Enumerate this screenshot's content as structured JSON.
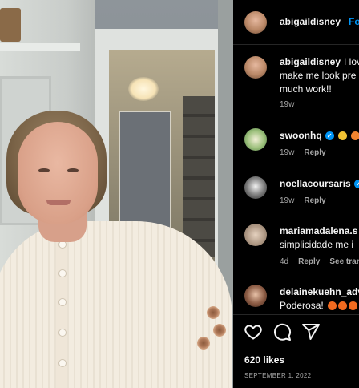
{
  "header": {
    "username": "abigaildisney",
    "follow_label": "Fo"
  },
  "caption": {
    "username": "abigaildisney",
    "line1": "I lov",
    "line2": "make me look pre",
    "line3": "much work!!",
    "time": "19w"
  },
  "comments": [
    {
      "username": "swoonhq",
      "text": "",
      "time": "19w",
      "reply": "Reply",
      "verified": true
    },
    {
      "username": "noellacoursaris",
      "text": "",
      "time": "19w",
      "reply": "Reply",
      "verified": true
    },
    {
      "username": "mariamadalena.s",
      "text": "simplicidade me i",
      "time": "4d",
      "reply": "Reply",
      "extra": "See tran"
    },
    {
      "username": "delainekuehn_adv",
      "text": "Poderosa! ",
      "time": "",
      "reply": ""
    }
  ],
  "footer": {
    "likes": "620 likes",
    "date": "SEPTEMBER 1, 2022"
  },
  "icons": [
    "heart-icon",
    "comment-icon",
    "share-icon"
  ],
  "colors": {
    "background": "#000000",
    "link": "#0095f6",
    "muted": "#a8a8a8"
  }
}
